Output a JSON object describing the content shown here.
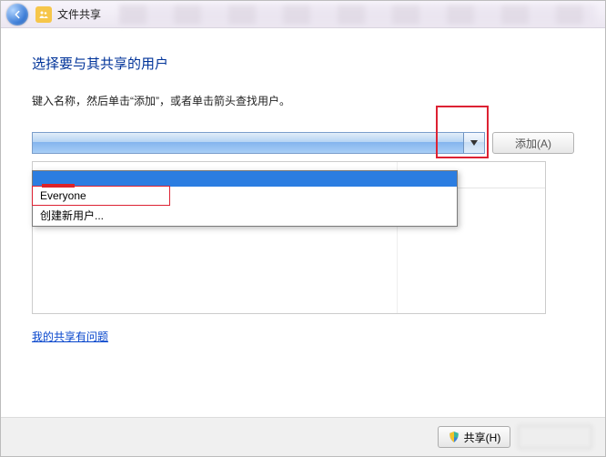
{
  "window": {
    "title": "文件共享"
  },
  "main": {
    "heading": "选择要与其共享的用户",
    "subtext": "键入名称，然后单击“添加”，或者单击箭头查找用户。",
    "combo_value": "",
    "add_button": "添加(A)",
    "dropdown": {
      "items": [
        {
          "label": "Everyone"
        },
        {
          "label": "创建新用户..."
        }
      ]
    },
    "help_link": "我的共享有问题"
  },
  "footer": {
    "share_button": "共享(H)"
  }
}
